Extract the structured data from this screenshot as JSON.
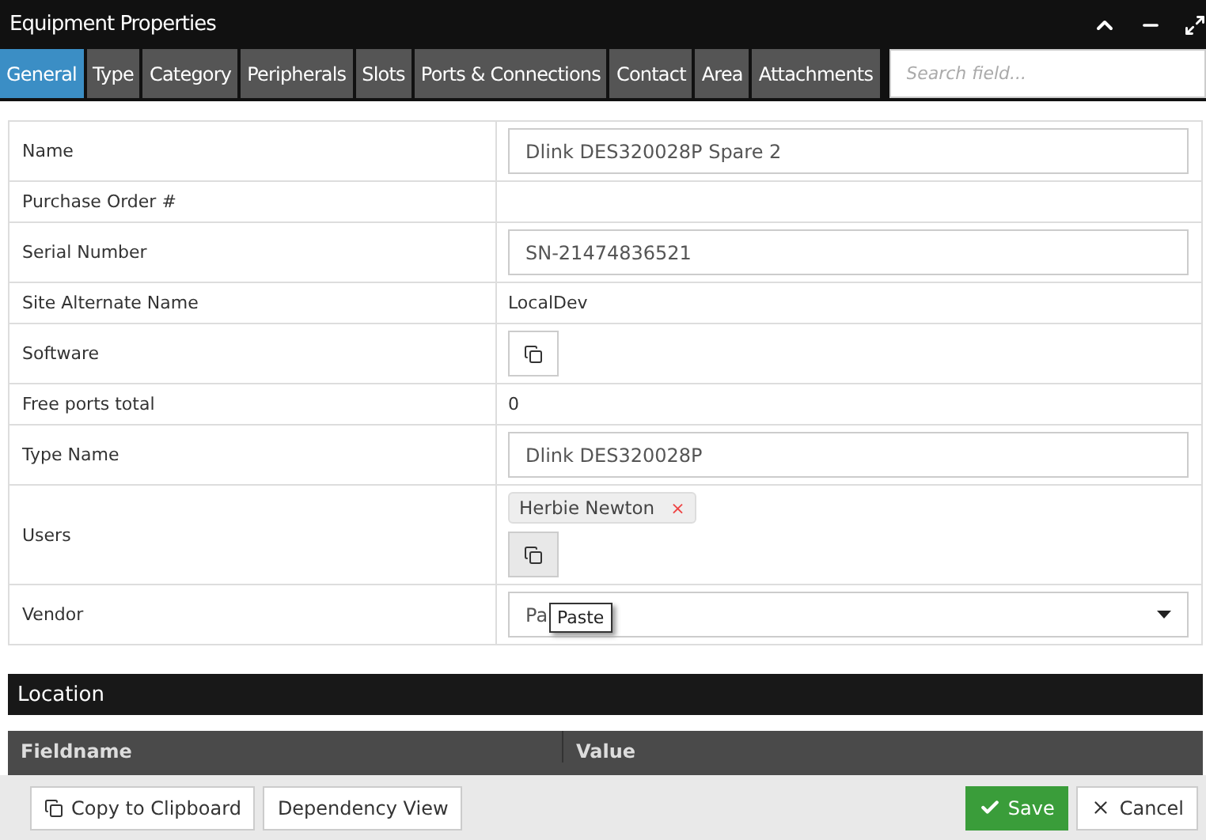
{
  "window": {
    "title": "Equipment Properties"
  },
  "tabs": [
    {
      "label": "General",
      "selected": true
    },
    {
      "label": "Type",
      "selected": false
    },
    {
      "label": "Category",
      "selected": false
    },
    {
      "label": "Peripherals",
      "selected": false
    },
    {
      "label": "Slots",
      "selected": false
    },
    {
      "label": "Ports & Connections",
      "selected": false
    },
    {
      "label": "Contact",
      "selected": false
    },
    {
      "label": "Area",
      "selected": false
    },
    {
      "label": "Attachments",
      "selected": false
    }
  ],
  "search": {
    "placeholder": "Search field..."
  },
  "properties": [
    {
      "kind": "input",
      "label": "Name",
      "value": "Dlink DES320028P Spare 2"
    },
    {
      "kind": "text",
      "label": "Purchase Order #"
    },
    {
      "kind": "input",
      "label": "Serial Number",
      "value": "SN-21474836521"
    },
    {
      "kind": "text",
      "label": "Site Alternate Name",
      "value": "LocalDev"
    },
    {
      "kind": "paste",
      "label": "Software"
    },
    {
      "kind": "text",
      "label": "Free ports total",
      "value": "0"
    },
    {
      "kind": "input",
      "label": "Type Name",
      "value": "Dlink DES320028P"
    },
    {
      "kind": "users",
      "label": "Users",
      "tags": [
        "Herbie Newton"
      ],
      "remove": "×"
    },
    {
      "kind": "select",
      "label": "Vendor",
      "value": "Pa",
      "tooltip": "Paste"
    }
  ],
  "location": {
    "title": "Location",
    "columns": [
      "Fieldname",
      "Value"
    ]
  },
  "footer": {
    "left": [
      "Copy to Clipboard",
      "Dependency View"
    ],
    "save": "Save",
    "cancel": "Cancel"
  }
}
